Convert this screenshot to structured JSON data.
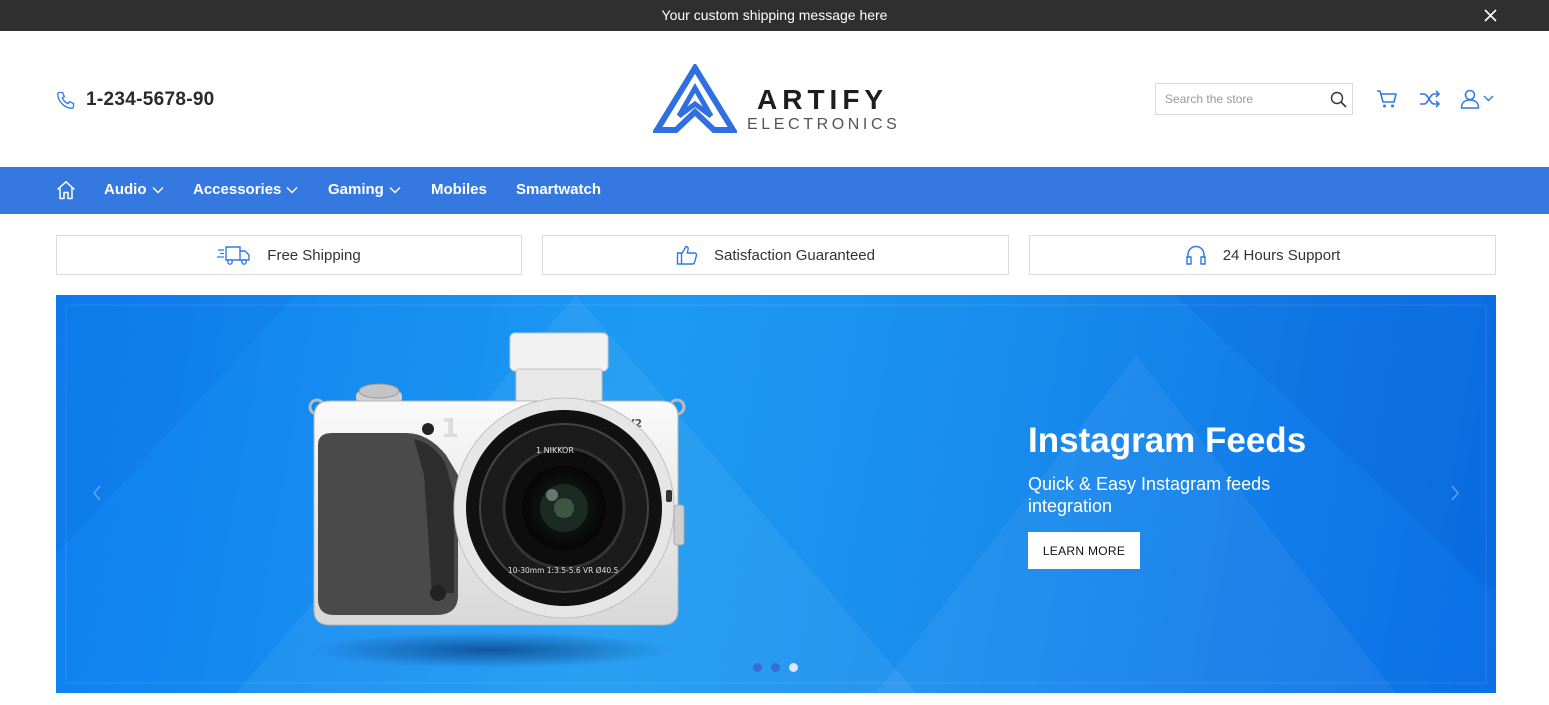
{
  "topbar": {
    "message": "Your custom shipping message here"
  },
  "header": {
    "phone": "1-234-5678-90",
    "logo": {
      "brand": "ARTIFY",
      "subtitle": "ELECTRONICS"
    },
    "search": {
      "placeholder": "Search the store",
      "value": ""
    }
  },
  "nav": {
    "items": [
      {
        "label": "Audio",
        "has_dropdown": true
      },
      {
        "label": "Accessories",
        "has_dropdown": true
      },
      {
        "label": "Gaming",
        "has_dropdown": true
      },
      {
        "label": "Mobiles",
        "has_dropdown": false
      },
      {
        "label": "Smartwatch",
        "has_dropdown": false
      }
    ]
  },
  "features": [
    {
      "label": "Free Shipping",
      "icon": "truck-icon"
    },
    {
      "label": "Satisfaction Guaranteed",
      "icon": "thumbs-up-icon"
    },
    {
      "label": "24 Hours Support",
      "icon": "headphones-icon"
    }
  ],
  "slider": {
    "title": "Instagram Feeds",
    "subtitle": "Quick & Easy Instagram feeds integration",
    "button_label": "LEARN MORE",
    "camera": {
      "model_badge": "V2",
      "lens_text_top": "1 NIKKOR",
      "lens_text_bottom": "10-30mm 1:3.5-5.6 VR Ø40.5"
    },
    "active_slide": 3,
    "slide_count": 3
  },
  "colors": {
    "topbar": "#2f2f2f",
    "nav": "#3579e0",
    "accent": "#2f7ae5",
    "slider_bg": "#1a8fee"
  }
}
